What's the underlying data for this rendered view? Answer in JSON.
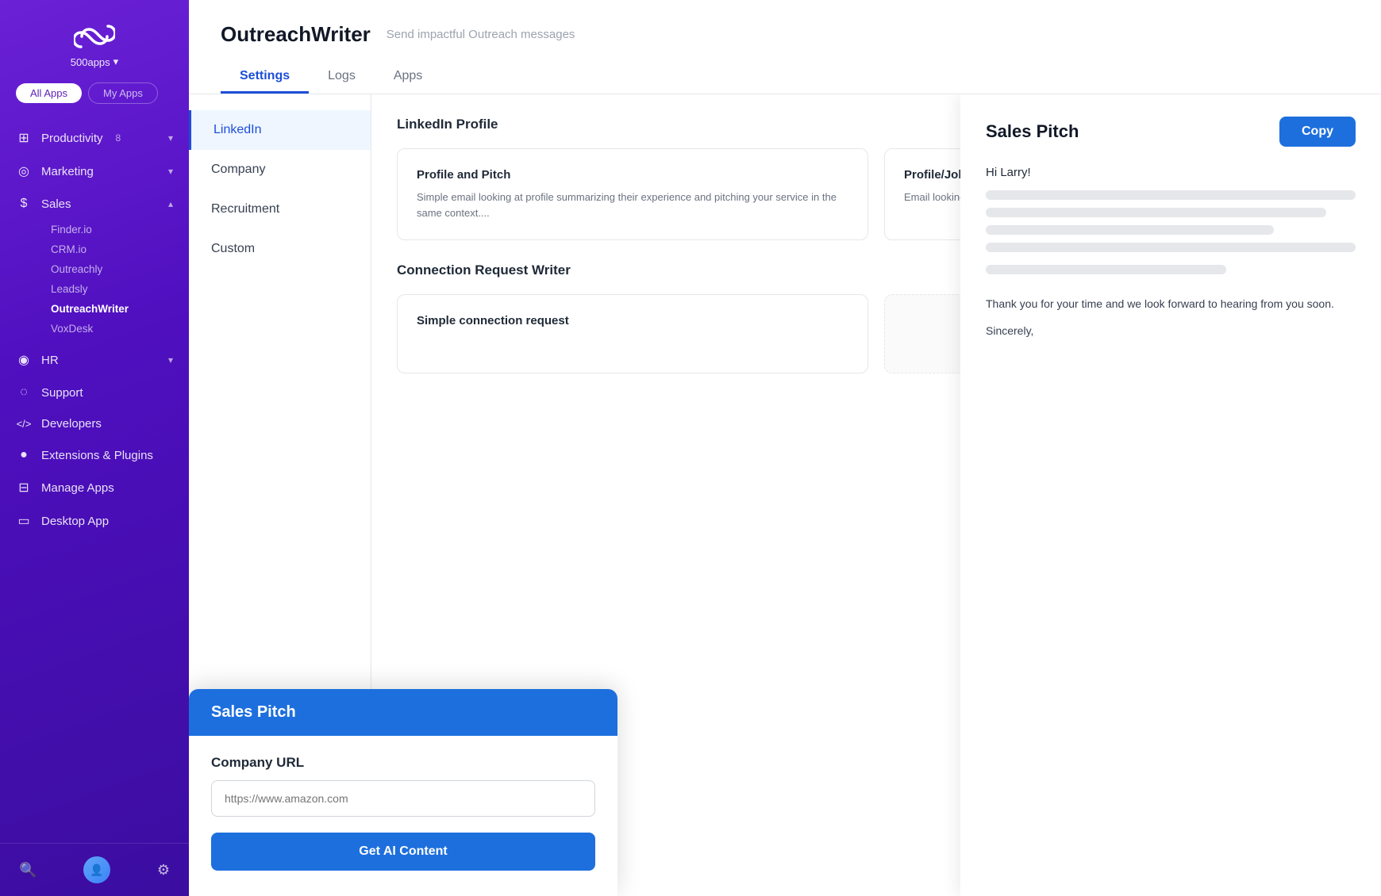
{
  "sidebar": {
    "logo_text": "500apps",
    "tabs": [
      {
        "label": "All Apps",
        "active": true
      },
      {
        "label": "My Apps",
        "active": false
      }
    ],
    "nav_items": [
      {
        "icon": "⊞",
        "label": "Productivity",
        "badge": "8",
        "has_chevron": true,
        "expanded": false
      },
      {
        "icon": "◎",
        "label": "Marketing",
        "has_chevron": true,
        "expanded": false
      },
      {
        "icon": "$",
        "label": "Sales",
        "has_chevron": true,
        "expanded": true
      },
      {
        "icon": "◉",
        "label": "HR",
        "has_chevron": true,
        "expanded": false
      },
      {
        "icon": "◌",
        "label": "Support",
        "has_chevron": false,
        "expanded": false
      },
      {
        "icon": "<>",
        "label": "Developers",
        "has_chevron": false,
        "expanded": false
      },
      {
        "icon": "●",
        "label": "Extensions & Plugins",
        "has_chevron": false,
        "expanded": false
      },
      {
        "icon": "⊟",
        "label": "Manage Apps",
        "has_chevron": false,
        "expanded": false
      },
      {
        "icon": "▭",
        "label": "Desktop App",
        "has_chevron": false,
        "expanded": false
      }
    ],
    "sales_sub_items": [
      {
        "label": "Finder.io",
        "active": false
      },
      {
        "label": "CRM.io",
        "active": false
      },
      {
        "label": "Outreachly",
        "active": false
      },
      {
        "label": "Leadsly",
        "active": false
      },
      {
        "label": "OutreachWriter",
        "active": true
      },
      {
        "label": "VoxDesk",
        "active": false
      }
    ],
    "bottom_icons": [
      "🔍",
      "👤",
      "⚙"
    ]
  },
  "header": {
    "app_title": "OutreachWriter",
    "app_subtitle": "Send impactful Outreach messages",
    "tabs": [
      {
        "label": "Settings",
        "active": true
      },
      {
        "label": "Logs",
        "active": false
      },
      {
        "label": "Apps",
        "active": false
      }
    ]
  },
  "settings_sidebar": {
    "items": [
      {
        "label": "LinkedIn",
        "active": true
      },
      {
        "label": "Company",
        "active": false
      },
      {
        "label": "Recruitment",
        "active": false
      },
      {
        "label": "Custom",
        "active": false
      }
    ]
  },
  "linkedin_section": {
    "section_title": "LinkedIn Profile",
    "cards": [
      {
        "title": "Profile and Pitch",
        "description": "Simple email looking at profile summarizing their experience and pitching your service in the same context...."
      },
      {
        "title": "Profile/Job Changes and Pitch",
        "description": "Email looking at profile and job changes and pitching your service in the same...."
      }
    ]
  },
  "connection_section": {
    "title": "Connection Request Writer",
    "cards": [
      {
        "title": "Simple connection request",
        "description": ""
      }
    ]
  },
  "overlay": {
    "title": "Sales Pitch",
    "field_label": "Company URL",
    "field_placeholder": "https://www.amazon.com",
    "button_label": "Get AI Content"
  },
  "result_panel": {
    "title": "Sales Pitch",
    "copy_label": "Copy",
    "greeting": "Hi Larry!",
    "footer_text": "Thank you for your time and we look forward to hearing from you soon.",
    "sign_off": "Sincerely,"
  }
}
